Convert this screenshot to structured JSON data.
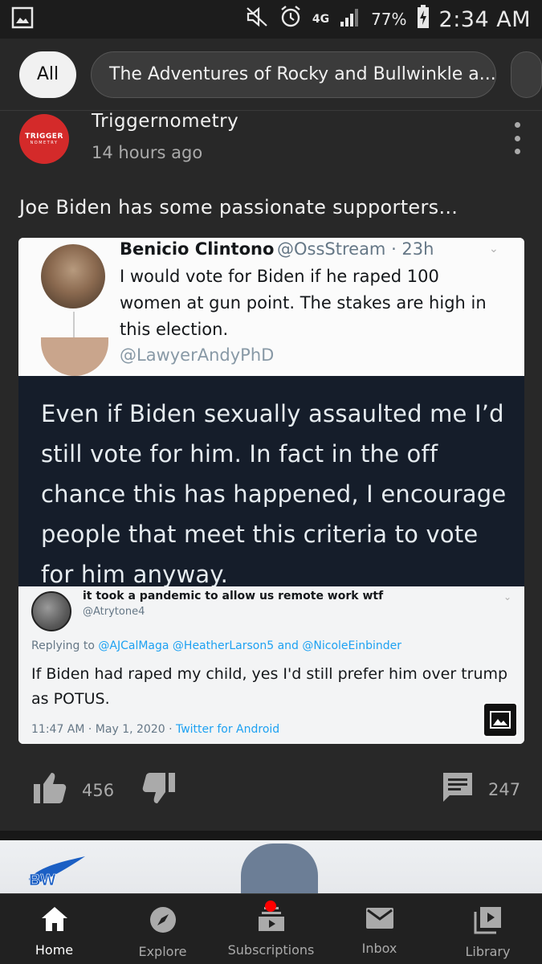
{
  "status_bar": {
    "network": "4G",
    "battery_percent": "77%",
    "time": "2:34 AM"
  },
  "chips": [
    {
      "label": "All",
      "selected": true
    },
    {
      "label": "The Adventures of Rocky and Bullwinkle a...",
      "selected": false
    }
  ],
  "post": {
    "channel_avatar_text": "TRIGGER",
    "channel_avatar_subtext": "NOMETRY",
    "channel_name": "Triggernometry",
    "time_ago": "14 hours ago",
    "text": "Joe Biden has some passionate supporters...",
    "image": {
      "tweet1": {
        "name": "Benicio Clintono",
        "handle_time": "@OssStream · 23h",
        "text": "I would vote for Biden if he raped 100 women at gun point. The stakes are high in this election."
      },
      "tweet2": {
        "handle": "@LawyerAndyPhD",
        "text": "Even if Biden sexually assaulted me I’d still vote for him. In fact in the off chance this has happened, I encourage people that meet this criteria to vote for him anyway."
      },
      "tweet3": {
        "name": "it took a pandemic to allow us remote work wtf",
        "handle": "@Atrytone4",
        "replying_prefix": "Replying to ",
        "replying_to": "@AJCalMaga @HeatherLarson5 and @NicoleEinbinder",
        "text": "If Biden had raped my child, yes I'd still prefer him over trump as POTUS.",
        "meta_date": "11:47 AM · May 1, 2020 · ",
        "meta_source": "Twitter for Android"
      }
    },
    "likes": "456",
    "comments": "247"
  },
  "nav": [
    {
      "label": "Home",
      "icon": "home-icon",
      "active": true
    },
    {
      "label": "Explore",
      "icon": "compass-icon",
      "active": false
    },
    {
      "label": "Subscriptions",
      "icon": "subscriptions-icon",
      "active": false
    },
    {
      "label": "Inbox",
      "icon": "mail-icon",
      "active": false
    },
    {
      "label": "Library",
      "icon": "library-icon",
      "active": false
    }
  ],
  "colors": {
    "background": "#282828",
    "accent_red": "#ff0000",
    "link_blue": "#1da1f2"
  }
}
